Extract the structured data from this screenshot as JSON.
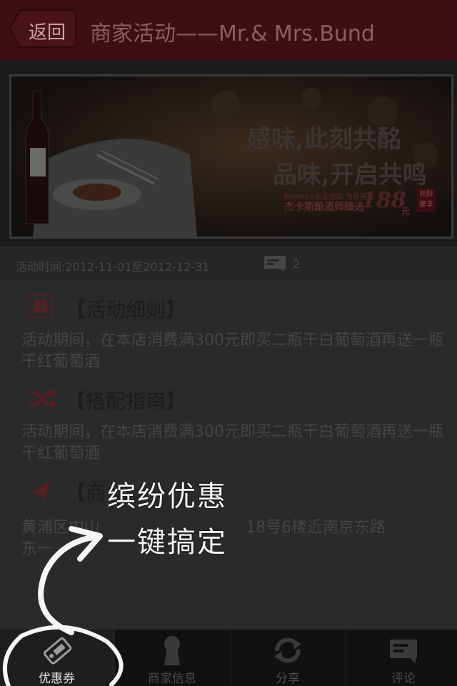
{
  "header": {
    "back_label": "返回",
    "title": "商家活动——Mr.& Mrs.Bund"
  },
  "banner": {
    "line1": "感味,此刻共酩",
    "line2": "品味,开启共鸣",
    "small1": "MGM10名全酒类·为你带来",
    "small2": "杰卡斯酿酒师臻选",
    "price": "188",
    "price_unit": "元",
    "stamp": "共醉惠享"
  },
  "info": {
    "time": "活动时间:2012-11-01至2012-12-31",
    "comment_count": "2"
  },
  "sections": [
    {
      "title": "【活动细则】",
      "body": "活动期间，在本店消费满300元即买二瓶干白葡萄酒再送一瓶干红葡萄酒"
    },
    {
      "title": "【搭配指南】",
      "body": "活动期间，在本店消费满300元即买二瓶干白葡萄酒再送一瓶干红葡萄酒"
    },
    {
      "title": "【商",
      "body": "黄浦区中山东一",
      "body_tail": "18号6楼近南京东路"
    }
  ],
  "overlay": {
    "line1": "缤纷优惠",
    "line2": "一键搞定"
  },
  "tabs": [
    {
      "label": "优惠券",
      "icon": "coupon-tag-icon"
    },
    {
      "label": "商家信息",
      "icon": "keyhole-icon"
    },
    {
      "label": "分享",
      "icon": "share-refresh-icon"
    },
    {
      "label": "评论",
      "icon": "comment-icon"
    }
  ],
  "colors": {
    "header_bg": "#3e0e16",
    "accent": "#8c5d64",
    "section_icon": "#5a1f22"
  }
}
